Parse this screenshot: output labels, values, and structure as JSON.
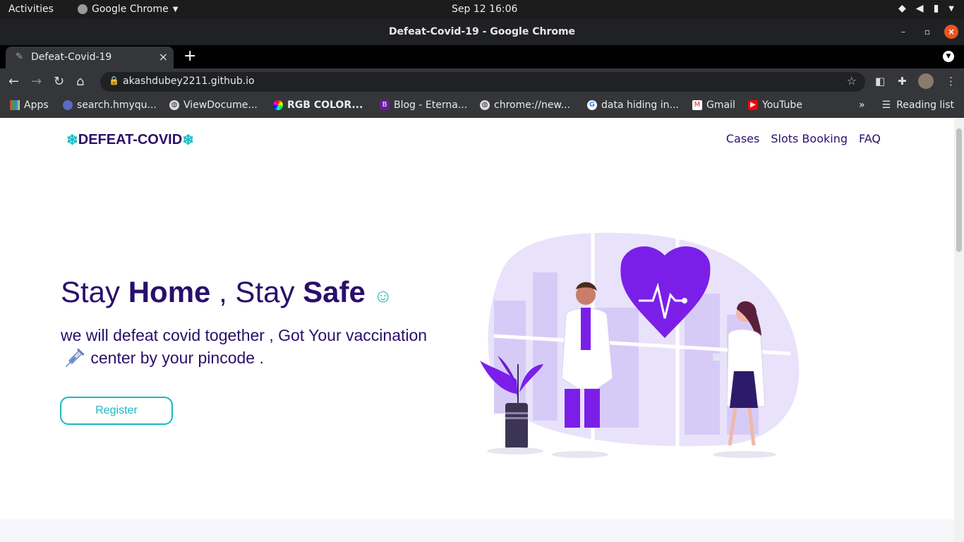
{
  "os_bar": {
    "activities": "Activities",
    "app_name": "Google Chrome",
    "clock": "Sep 12  16:06"
  },
  "window": {
    "title": "Defeat-Covid-19 - Google Chrome"
  },
  "tabs": [
    {
      "label": "Defeat-Covid-19"
    }
  ],
  "toolbar": {
    "url": "akashdubey2211.github.io"
  },
  "bookmarks": {
    "items": [
      {
        "label": "Apps",
        "icon": "apps-grid-icon"
      },
      {
        "label": "search.hmyqu...",
        "icon": "spinner-icon"
      },
      {
        "label": "ViewDocume...",
        "icon": "globe-icon"
      },
      {
        "label": "RGB COLOR...",
        "icon": "color-wheel-icon"
      },
      {
        "label": "Blog - Eterna...",
        "icon": "b-badge-icon"
      },
      {
        "label": "chrome://new...",
        "icon": "globe-icon"
      },
      {
        "label": "data hiding in...",
        "icon": "google-icon"
      },
      {
        "label": "Gmail",
        "icon": "gmail-icon"
      },
      {
        "label": "YouTube",
        "icon": "youtube-icon"
      }
    ],
    "overflow": "»",
    "reading_list": "Reading list"
  },
  "site": {
    "brand": "DEFEAT-COVID",
    "nav": [
      "Cases",
      "Slots Booking",
      "FAQ"
    ],
    "hero": {
      "title_part1": "Stay ",
      "title_bold1": "Home",
      "title_part2": " , Stay ",
      "title_bold2": "Safe",
      "subtitle_line1": "we will defeat covid together , Got Your vaccination",
      "subtitle_line2": " center by your pincode .",
      "register_label": "Register"
    }
  },
  "colors": {
    "brand_purple": "#2a0f6b",
    "accent_teal": "#1ab7c5",
    "illustration_purple": "#7b1fe8"
  }
}
